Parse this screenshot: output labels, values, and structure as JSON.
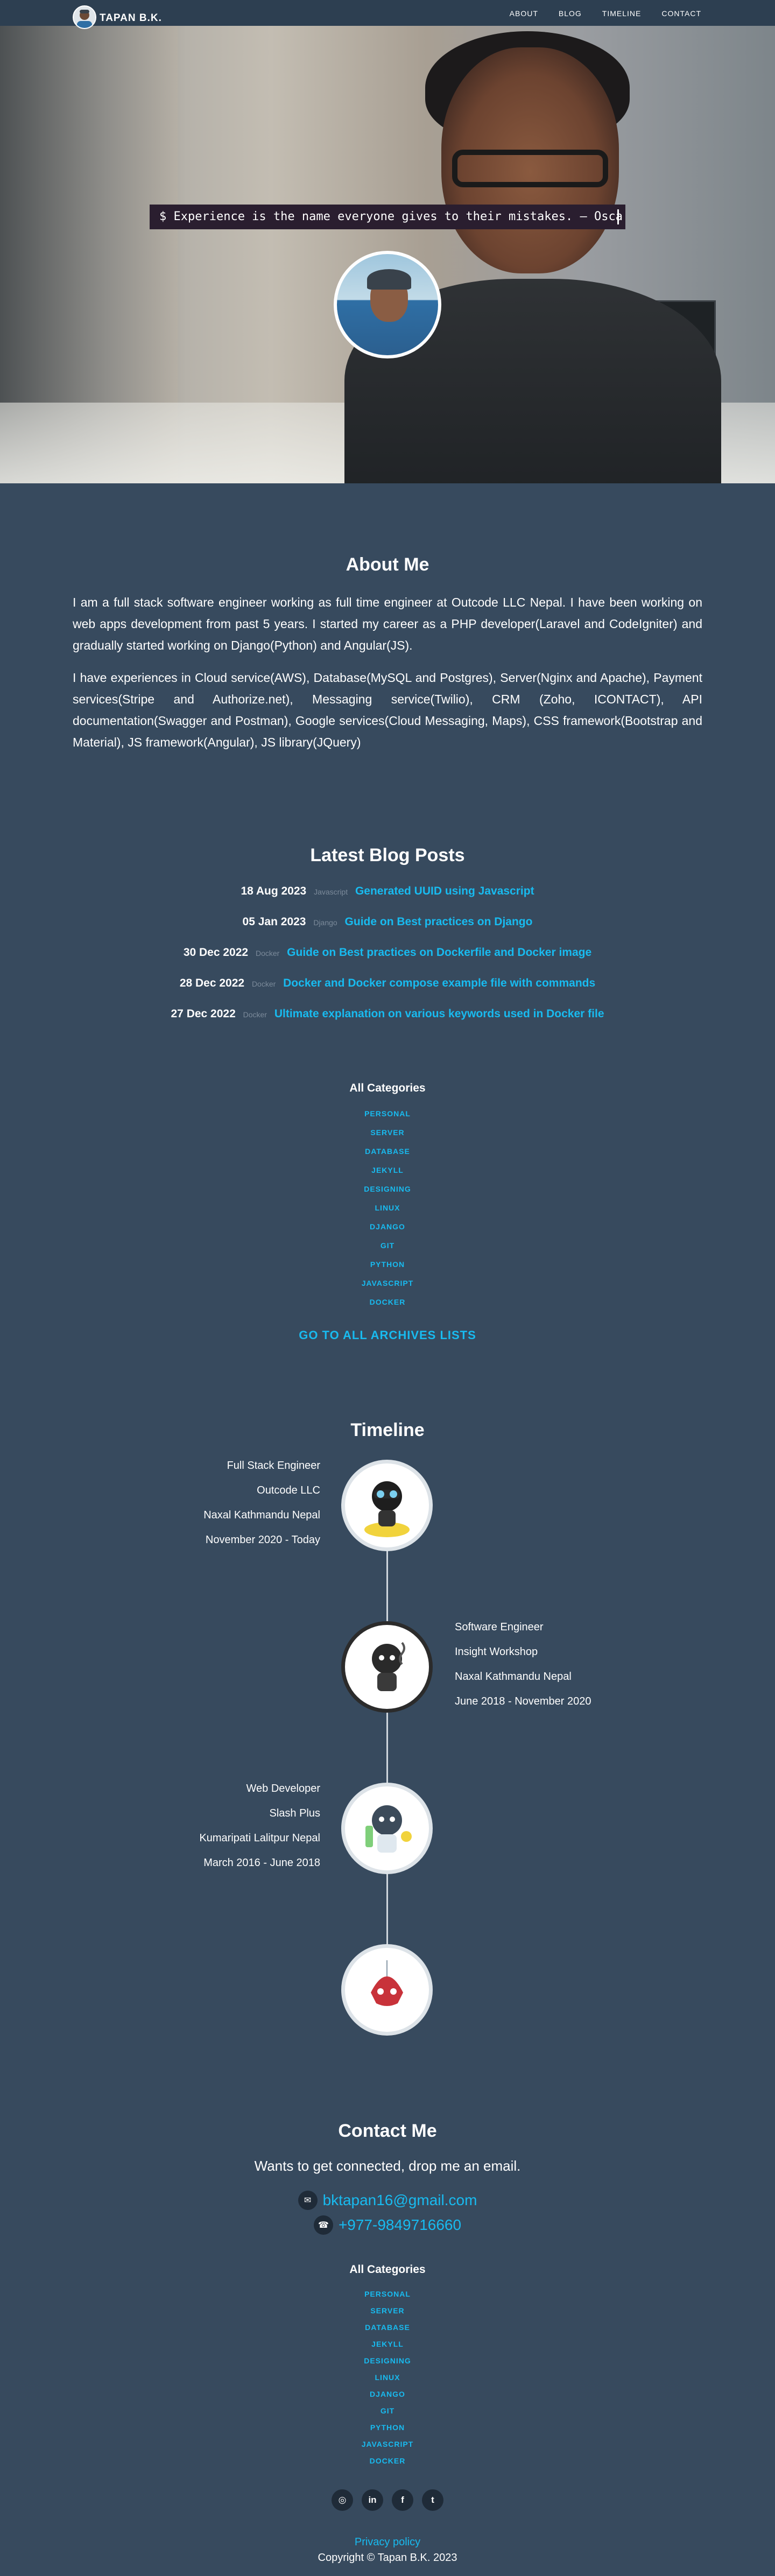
{
  "nav": {
    "brand": "TAPAN B.K.",
    "links": [
      "ABOUT",
      "BLOG",
      "TIMELINE",
      "CONTACT"
    ]
  },
  "hero": {
    "typed_text": "$ Experience is the name everyone gives to their mistakes. – Osca"
  },
  "about": {
    "title": "About Me",
    "paragraphs": [
      "I am a full stack software engineer working as full time engineer at Outcode LLC Nepal. I have been working on web apps development from past 5 years. I started my career as a PHP developer(Laravel and CodeIgniter) and gradually started working on Django(Python) and Angular(JS).",
      "I have experiences in Cloud service(AWS), Database(MySQL and Postgres), Server(Nginx and Apache), Payment services(Stripe and Authorize.net), Messaging service(Twilio), CRM (Zoho, ICONTACT), API documentation(Swagger and Postman), Google services(Cloud Messaging, Maps), CSS framework(Bootstrap and Material), JS framework(Angular), JS library(JQuery)"
    ]
  },
  "blog": {
    "title": "Latest Blog Posts",
    "posts": [
      {
        "date": "18 Aug 2023",
        "category": "Javascript",
        "title": "Generated UUID using Javascript"
      },
      {
        "date": "05 Jan 2023",
        "category": "Django",
        "title": "Guide on Best practices on Django"
      },
      {
        "date": "30 Dec 2022",
        "category": "Docker",
        "title": "Guide on Best practices on Dockerfile and Docker image"
      },
      {
        "date": "28 Dec 2022",
        "category": "Docker",
        "title": "Docker and Docker compose example file with commands"
      },
      {
        "date": "27 Dec 2022",
        "category": "Docker",
        "title": "Ultimate explanation on various keywords used in Docker file"
      }
    ]
  },
  "categories": {
    "heading": "All Categories",
    "items": [
      "PERSONAL",
      "SERVER",
      "DATABASE",
      "JEKYLL",
      "DESIGNING",
      "LINUX",
      "DJANGO",
      "GIT",
      "PYTHON",
      "JAVASCRIPT",
      "DOCKER"
    ]
  },
  "archives_link": "GO TO ALL ARCHIVES LISTS",
  "timeline": {
    "title": "Timeline",
    "entries": [
      {
        "role": "Full Stack Engineer",
        "company": "Outcode LLC",
        "location": "Naxal Kathmandu Nepal",
        "period": "November 2020 - Today"
      },
      {
        "role": "Software Engineer",
        "company": "Insight Workshop",
        "location": "Naxal Kathmandu Nepal",
        "period": "June 2018 - November 2020"
      },
      {
        "role": "Web Developer",
        "company": "Slash Plus",
        "location": "Kumaripati Lalitpur Nepal",
        "period": "March 2016 - June 2018"
      }
    ]
  },
  "contact": {
    "title": "Contact Me",
    "subtitle": "Wants to get connected, drop me an email.",
    "email": "bktapan16@gmail.com",
    "phone": "+977-9849716660"
  },
  "socials": [
    {
      "name": "github",
      "glyph": "◎"
    },
    {
      "name": "linkedin",
      "glyph": "in"
    },
    {
      "name": "facebook",
      "glyph": "f"
    },
    {
      "name": "twitter",
      "glyph": "t"
    }
  ],
  "footer": {
    "privacy": "Privacy policy",
    "copyright": "Copyright © Tapan B.K. 2023"
  }
}
